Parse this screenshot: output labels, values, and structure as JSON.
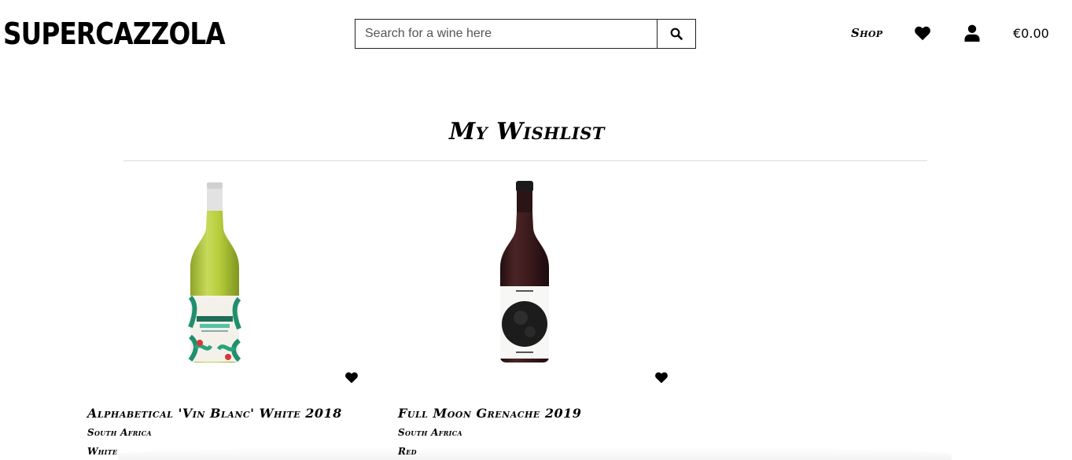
{
  "header": {
    "logo": "SUPERCAZZOLA",
    "search_placeholder": "Search for a wine here",
    "search_icon": "search-icon",
    "nav": {
      "shop_label": "Shop",
      "wishlist_icon": "heart-icon",
      "account_icon": "user-icon",
      "cart_total": "€0.00"
    }
  },
  "page": {
    "title": "My Wishlist"
  },
  "wishlist": [
    {
      "name": "Alphabetical 'Vin Blanc' White 2018",
      "country": "South Africa",
      "type": "White",
      "image": "white-wine-bottle",
      "wishlist_icon": "heart-icon"
    },
    {
      "name": "Full Moon Grenache 2019",
      "country": "South Africa",
      "type": "Red",
      "image": "red-wine-bottle",
      "wishlist_icon": "heart-icon"
    }
  ],
  "colors": {
    "text": "#000000",
    "background": "#ffffff",
    "divider": "#dcdcdc",
    "white_wine_glass": "#b6cc3c",
    "red_wine_glass": "#3b1a1c"
  }
}
